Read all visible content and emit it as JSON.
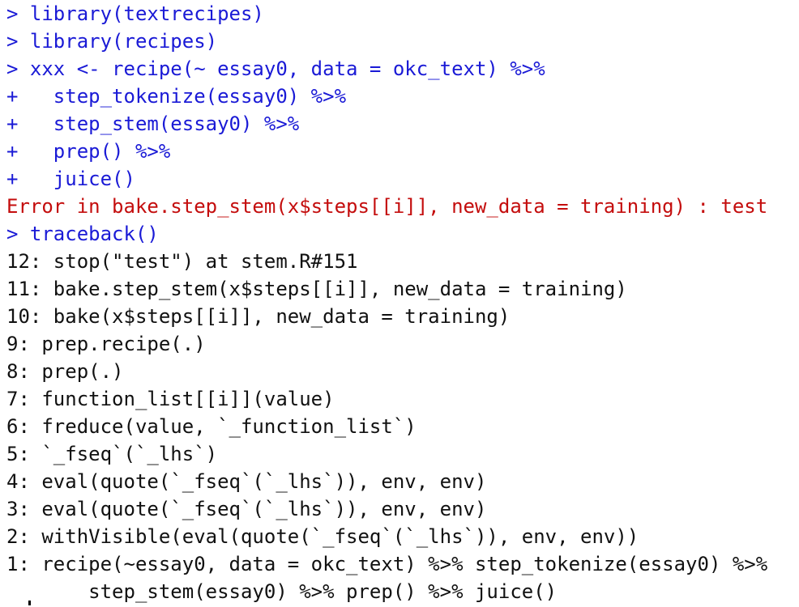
{
  "console": {
    "lines": [
      {
        "type": "input",
        "text": "> library(textrecipes)"
      },
      {
        "type": "input",
        "text": "> library(recipes)"
      },
      {
        "type": "input",
        "text": "> xxx <- recipe(~ essay0, data = okc_text) %>%"
      },
      {
        "type": "input",
        "text": "+   step_tokenize(essay0) %>%"
      },
      {
        "type": "input",
        "text": "+   step_stem(essay0) %>%"
      },
      {
        "type": "input",
        "text": "+   prep() %>%"
      },
      {
        "type": "input",
        "text": "+   juice()"
      },
      {
        "type": "error",
        "text": "Error in bake.step_stem(x$steps[[i]], new_data = training) : test"
      },
      {
        "type": "input",
        "text": "> traceback()"
      },
      {
        "type": "output",
        "text": "12: stop(\"test\") at stem.R#151"
      },
      {
        "type": "output",
        "text": "11: bake.step_stem(x$steps[[i]], new_data = training)"
      },
      {
        "type": "output",
        "text": "10: bake(x$steps[[i]], new_data = training)"
      },
      {
        "type": "output",
        "text": "9: prep.recipe(.)"
      },
      {
        "type": "output",
        "text": "8: prep(.)"
      },
      {
        "type": "output",
        "text": "7: function_list[[i]](value)"
      },
      {
        "type": "output",
        "text": "6: freduce(value, `_function_list`)"
      },
      {
        "type": "output",
        "text": "5: `_fseq`(`_lhs`)"
      },
      {
        "type": "output",
        "text": "4: eval(quote(`_fseq`(`_lhs`)), env, env)"
      },
      {
        "type": "output",
        "text": "3: eval(quote(`_fseq`(`_lhs`)), env, env)"
      },
      {
        "type": "output",
        "text": "2: withVisible(eval(quote(`_fseq`(`_lhs`)), env, env))"
      },
      {
        "type": "output",
        "text": "1: recipe(~essay0, data = okc_text) %>% step_tokenize(essay0) %>%"
      },
      {
        "type": "output",
        "text": "       step_stem(essay0) %>% prep() %>% juice()"
      }
    ]
  },
  "colors": {
    "input": "#1a1ad6",
    "error": "#c40d0d",
    "output": "#111111",
    "background": "#ffffff"
  }
}
